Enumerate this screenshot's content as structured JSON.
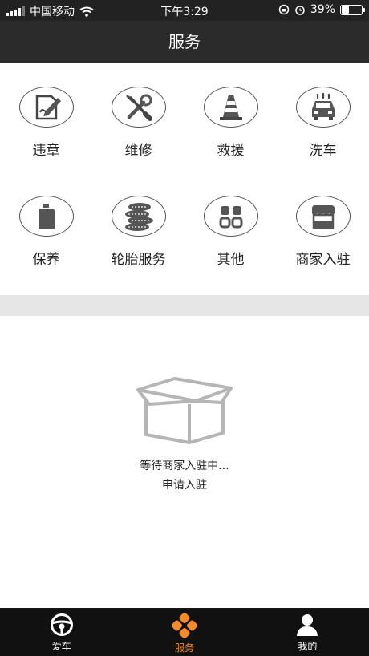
{
  "status_bar": {
    "carrier": "中国移动",
    "time": "下午3:29",
    "battery": "39%",
    "battery_level": 0.39
  },
  "nav": {
    "title": "服务"
  },
  "services": [
    {
      "label": "违章",
      "icon": "violation-icon"
    },
    {
      "label": "维修",
      "icon": "repair-tools-icon"
    },
    {
      "label": "救援",
      "icon": "traffic-cone-icon"
    },
    {
      "label": "洗车",
      "icon": "car-wash-icon"
    },
    {
      "label": "保养",
      "icon": "oil-can-icon"
    },
    {
      "label": "轮胎服务",
      "icon": "tires-icon"
    },
    {
      "label": "其他",
      "icon": "grid-icon"
    },
    {
      "label": "商家入驻",
      "icon": "store-icon"
    }
  ],
  "empty_state": {
    "message": "等待商家入驻中...",
    "link": "申请入驻"
  },
  "tabbar": {
    "tabs": [
      {
        "label": "爱车",
        "icon": "steering-wheel-icon",
        "active": false
      },
      {
        "label": "服务",
        "icon": "service-flower-icon",
        "active": true
      },
      {
        "label": "我的",
        "icon": "user-icon",
        "active": false
      }
    ],
    "active_color": "#f28a2e"
  }
}
